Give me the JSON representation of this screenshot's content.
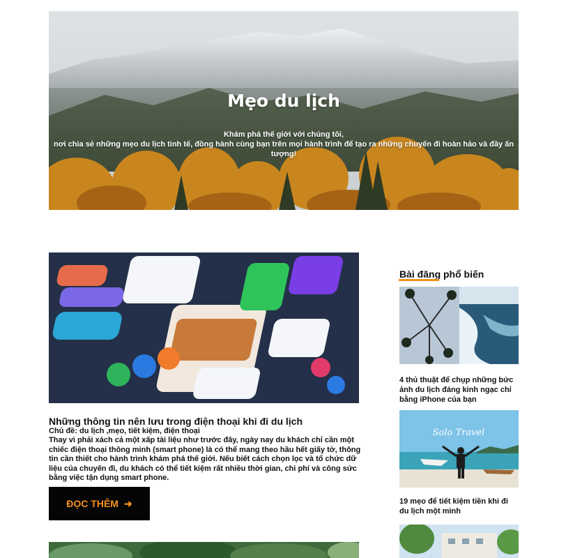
{
  "hero": {
    "title": "Mẹo du lịch",
    "subtitle_line1": "Khám phá thế giới với chúng tôi,",
    "subtitle_line2": "nơi chia sẻ những mẹo du lịch tinh tế, đồng hành cùng bạn trên mọi hành trình để tạo ra những chuyến đi hoàn hảo và đầy ấn tượng!"
  },
  "post": {
    "title": "Những thông tin nên lưu trong điện thoại khi đi du lịch",
    "meta": "Chủ đề: du lịch ,mẹo, tiết kiệm, điện thoại",
    "excerpt": "Thay vì phải xách cả một xấp tài liệu như trước đây, ngày nay du khách chỉ cần một chiếc điện thoại thông minh (smart phone) là có thể mang theo hầu hết giấy tờ, thông tin cần thiết cho hành trình khám phá thế giới. Nếu biết cách chọn lọc và tổ chức dữ liệu của chuyến đi, du khách có thể tiết kiệm rất nhiều thời gian, chi phí và công sức bằng việc tận dụng smart phone.",
    "read_more": "ĐỌC THÊM"
  },
  "sidebar": {
    "heading": "Bài đăng phổ biến",
    "items": [
      {
        "title": "4 thủ thuật để chụp những bức ảnh du lịch đáng kinh ngạc chỉ bằng iPhone của bạn"
      },
      {
        "title": "19 mẹo để tiết kiệm tiền khi đi du lịch một mình",
        "image_text": "Solo Travel"
      },
      {
        "title": ""
      }
    ]
  },
  "colors": {
    "accent": "#f5901e",
    "button_bg": "#050505"
  },
  "icons": {
    "read_more_arrow": "arrow-right-icon"
  }
}
